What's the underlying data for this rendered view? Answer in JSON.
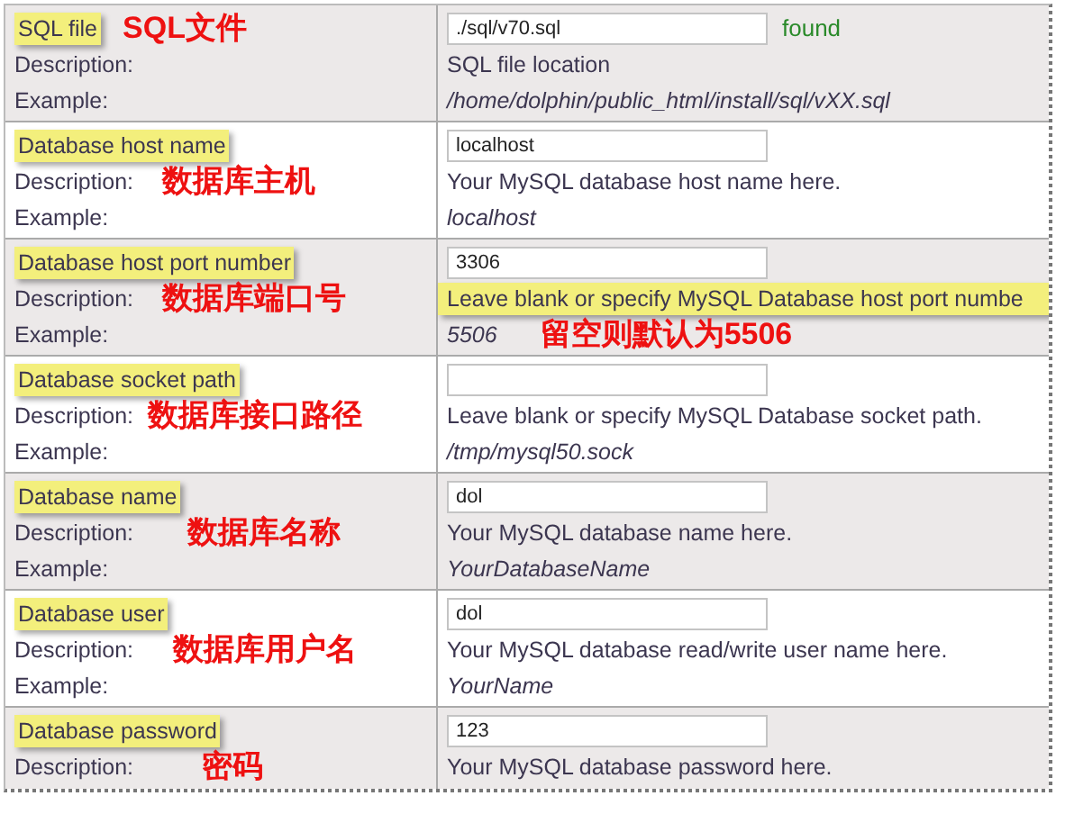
{
  "rows": [
    {
      "kind": "label",
      "label": "SQL file",
      "label_highlighted": true,
      "description_label": "Description:",
      "example_label": "Example:",
      "value": "./sql/v70.sql",
      "status": "found",
      "description": "SQL file location",
      "description_highlighted": false,
      "example": "/home/dolphin/public_html/install/sql/vXX.sql",
      "annotation": "SQL文件"
    },
    {
      "kind": "description",
      "label": "Database host name",
      "label_highlighted": true,
      "description_label": "Description:",
      "example_label": "Example:",
      "value": "localhost",
      "description": "Your MySQL database host name here.",
      "description_highlighted": false,
      "example": "localhost",
      "annotation": "数据库主机"
    },
    {
      "kind": "description",
      "label": "Database host port number",
      "label_highlighted": true,
      "description_label": "Description:",
      "example_label": "Example:",
      "value": "3306",
      "description": "Leave blank or specify MySQL Database host port numbe",
      "description_highlighted": true,
      "example": "5506",
      "annotation": "数据库端口号",
      "note": "留空则默认为5506"
    },
    {
      "kind": "description",
      "label": "Database socket path",
      "label_highlighted": true,
      "description_label": "Description:",
      "example_label": "Example:",
      "value": "",
      "description": "Leave blank or specify MySQL Database socket path.",
      "description_highlighted": false,
      "example": "/tmp/mysql50.sock",
      "annotation": "数据库接口路径"
    },
    {
      "kind": "description",
      "label": "Database name",
      "label_highlighted": true,
      "description_label": "Description:",
      "example_label": "Example:",
      "value": "dol",
      "description": "Your MySQL database name here.",
      "description_highlighted": false,
      "example": "YourDatabaseName",
      "annotation": "数据库名称"
    },
    {
      "kind": "description",
      "label": "Database user",
      "label_highlighted": true,
      "description_label": "Description:",
      "example_label": "Example:",
      "value": "dol",
      "description": "Your MySQL database read/write user name here.",
      "description_highlighted": false,
      "example": "YourName",
      "annotation": "数据库用户名"
    },
    {
      "kind": "description",
      "label": "Database password",
      "label_highlighted": true,
      "description_label": "Description:",
      "value": "123",
      "description": "Your MySQL database password here.",
      "description_highlighted": false,
      "annotation": "密码"
    }
  ]
}
